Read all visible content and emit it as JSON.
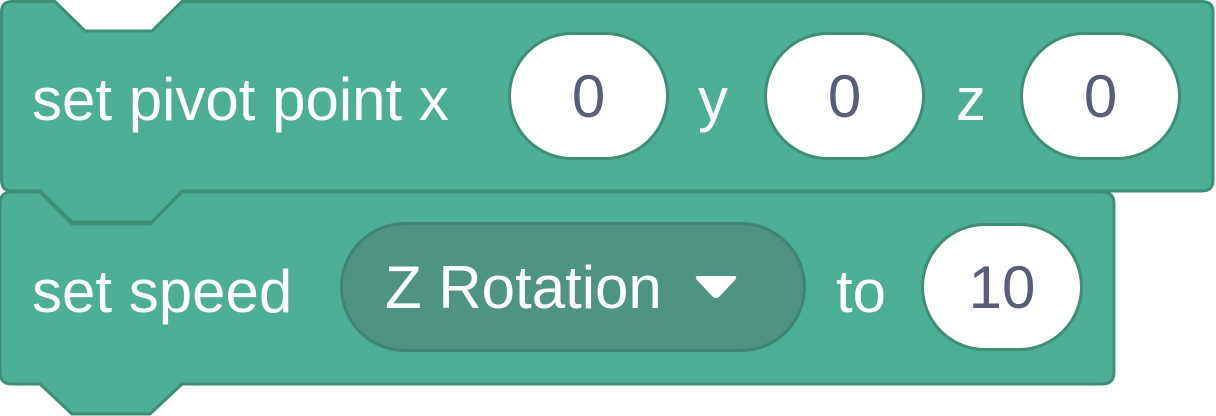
{
  "colors": {
    "block_fill": "#4cae94",
    "block_stroke": "#3e8e76",
    "dropdown_fill": "#4f9482",
    "input_fill": "#ffffff",
    "input_text": "#575e75",
    "label_text": "#ffffff"
  },
  "pivot_block": {
    "label": "set pivot point x",
    "y_label": "y",
    "z_label": "z",
    "x_value": "0",
    "y_value": "0",
    "z_value": "0"
  },
  "speed_block": {
    "label": "set speed",
    "dropdown_value": "Z Rotation",
    "dropdown_icon": "caret-down-icon",
    "to_label": "to",
    "speed_value": "10"
  }
}
